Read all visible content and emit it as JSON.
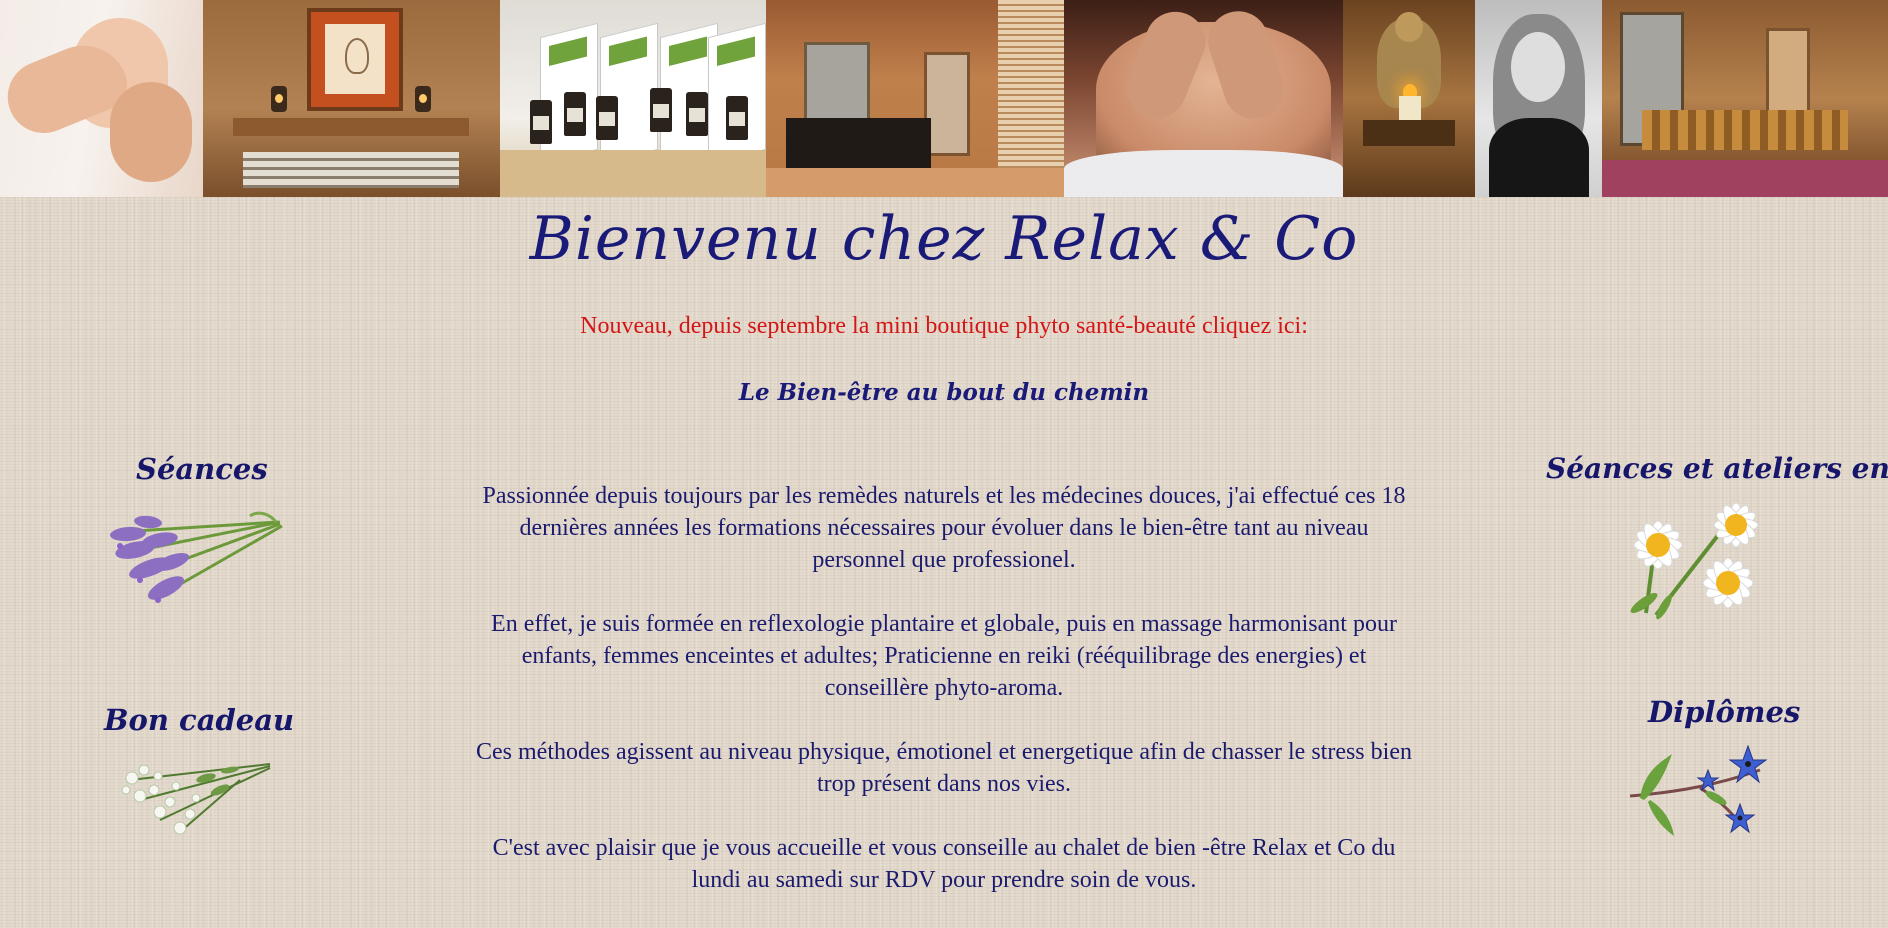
{
  "welcome_title": "Bienvenu chez Relax & Co",
  "news_line": "Nouveau, depuis septembre la mini boutique phyto santé-beauté cliquez ici:",
  "shop_link": "Le Bien-être au bout du chemin",
  "intro_paragraphs": [
    "Passionnée depuis toujours par les remèdes naturels et les médecines douces, j'ai effectué ces 18 dernières années les formations nécessaires pour évoluer dans le bien-être tant au niveau personnel que professionel.",
    "En effet, je suis formée en reflexologie plantaire et globale, puis en massage harmonisant pour enfants, femmes enceintes et adultes; Praticienne en reiki (rééquilibrage des energies) et conseillère phyto-aroma.",
    "Ces méthodes agissent au niveau physique, émotionel et energetique afin de chasser le stress bien trop présent dans nos vies.",
    "C'est avec plaisir que je vous accueille et vous conseille au chalet de bien -être Relax et Co du lundi au samedi sur RDV pour prendre soin de vous."
  ],
  "nav": {
    "seances": "Séances",
    "bon_cadeau": "Bon cadeau",
    "seances_enfants": "Séances et ateliers enfants",
    "diplomes": "Diplômes"
  },
  "banner_photos": [
    "reflexology-photo",
    "room-photo",
    "essential-oils-photo",
    "sauna-photo",
    "massage-photo",
    "buddha-candle-photo",
    "portrait-photo",
    "massage-room-photo"
  ],
  "colors": {
    "title_blue": "#1a1a78",
    "news_red": "#d51616",
    "background_linen": "#e3d9cc"
  }
}
